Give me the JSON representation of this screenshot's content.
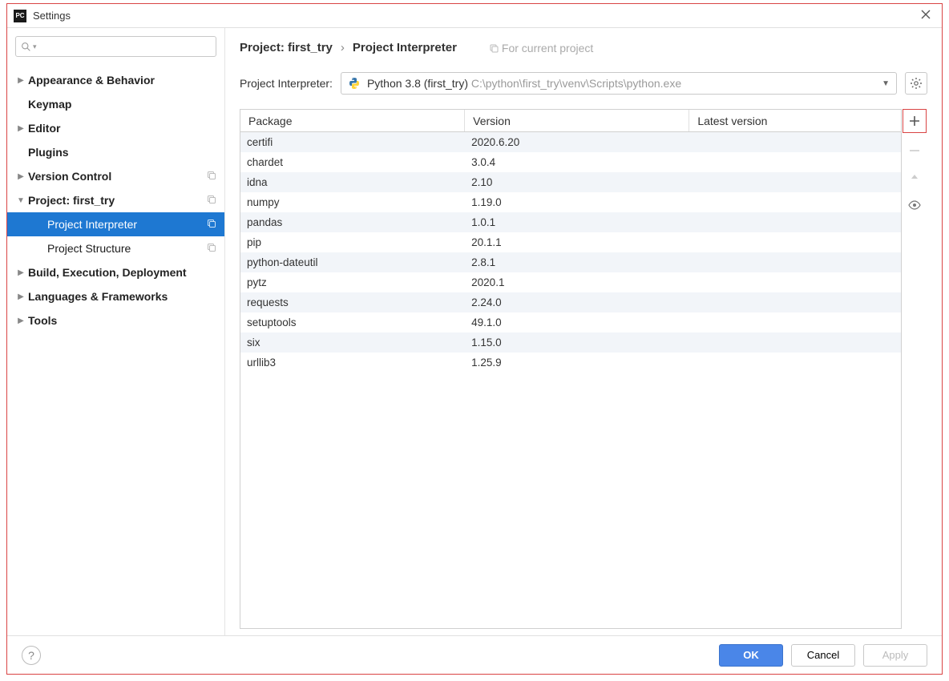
{
  "window": {
    "title": "Settings"
  },
  "breadcrumb": {
    "crumb1": "Project: first_try",
    "sep": "›",
    "crumb2": "Project Interpreter",
    "badge": "For current project"
  },
  "interpreter": {
    "label": "Project Interpreter:",
    "selected_name": "Python 3.8 (first_try) ",
    "selected_path": "C:\\python\\first_try\\venv\\Scripts\\python.exe"
  },
  "tree": {
    "items": [
      {
        "label": "Appearance & Behavior",
        "bold": true,
        "arrow": "right",
        "copy": false,
        "level": 0
      },
      {
        "label": "Keymap",
        "bold": true,
        "arrow": "none",
        "copy": false,
        "level": 0
      },
      {
        "label": "Editor",
        "bold": true,
        "arrow": "right",
        "copy": false,
        "level": 0
      },
      {
        "label": "Plugins",
        "bold": true,
        "arrow": "none",
        "copy": false,
        "level": 0
      },
      {
        "label": "Version Control",
        "bold": true,
        "arrow": "right",
        "copy": true,
        "level": 0
      },
      {
        "label": "Project: first_try",
        "bold": true,
        "arrow": "down",
        "copy": true,
        "level": 0
      },
      {
        "label": "Project Interpreter",
        "bold": false,
        "arrow": "none",
        "copy": true,
        "level": 1,
        "selected": true
      },
      {
        "label": "Project Structure",
        "bold": false,
        "arrow": "none",
        "copy": true,
        "level": 1
      },
      {
        "label": "Build, Execution, Deployment",
        "bold": true,
        "arrow": "right",
        "copy": false,
        "level": 0
      },
      {
        "label": "Languages & Frameworks",
        "bold": true,
        "arrow": "right",
        "copy": false,
        "level": 0
      },
      {
        "label": "Tools",
        "bold": true,
        "arrow": "right",
        "copy": false,
        "level": 0
      }
    ]
  },
  "table": {
    "headers": {
      "pkg": "Package",
      "ver": "Version",
      "lat": "Latest version"
    },
    "rows": [
      {
        "pkg": "certifi",
        "ver": "2020.6.20",
        "lat": ""
      },
      {
        "pkg": "chardet",
        "ver": "3.0.4",
        "lat": ""
      },
      {
        "pkg": "idna",
        "ver": "2.10",
        "lat": ""
      },
      {
        "pkg": "numpy",
        "ver": "1.19.0",
        "lat": ""
      },
      {
        "pkg": "pandas",
        "ver": "1.0.1",
        "lat": ""
      },
      {
        "pkg": "pip",
        "ver": "20.1.1",
        "lat": ""
      },
      {
        "pkg": "python-dateutil",
        "ver": "2.8.1",
        "lat": ""
      },
      {
        "pkg": "pytz",
        "ver": "2020.1",
        "lat": ""
      },
      {
        "pkg": "requests",
        "ver": "2.24.0",
        "lat": ""
      },
      {
        "pkg": "setuptools",
        "ver": "49.1.0",
        "lat": ""
      },
      {
        "pkg": "six",
        "ver": "1.15.0",
        "lat": ""
      },
      {
        "pkg": "urllib3",
        "ver": "1.25.9",
        "lat": ""
      }
    ]
  },
  "buttons": {
    "ok": "OK",
    "cancel": "Cancel",
    "apply": "Apply"
  }
}
